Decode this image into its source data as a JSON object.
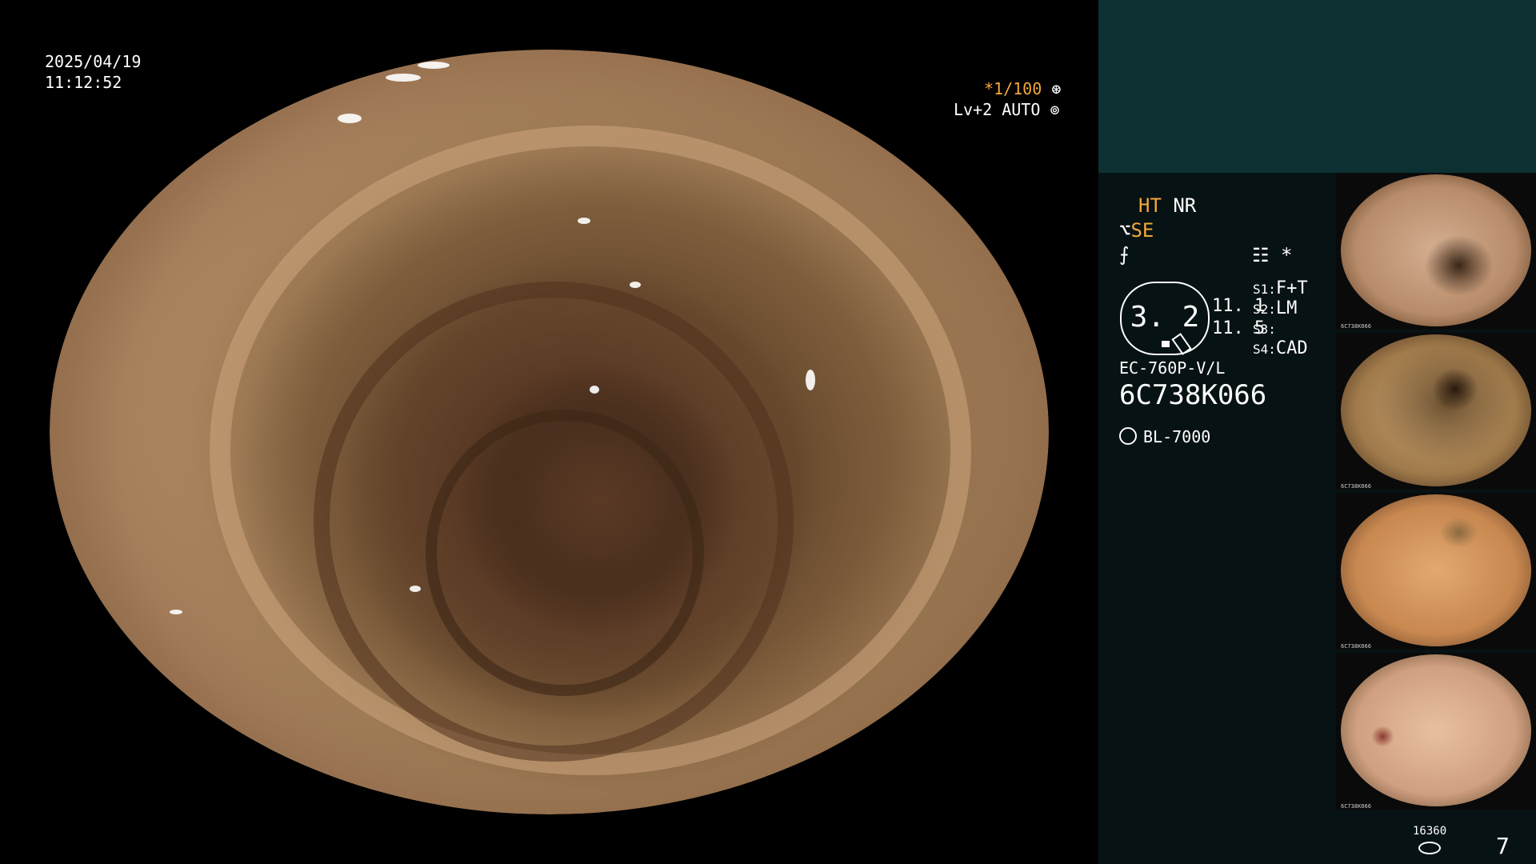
{
  "main": {
    "date": "2025/04/19",
    "time": "11:12:52",
    "shutter_prefix": "*",
    "shutter": "1/100",
    "shutter_icon": "aperture-icon",
    "level": "Lv+2",
    "auto": "AUTO",
    "auto_icon": "iris-icon"
  },
  "panel": {
    "ht": "HT",
    "nr": "NR",
    "se": "SE",
    "se_icon": "structure-enhance-icon",
    "f_icon": "color-mode-icon",
    "mode_icon": "settings-icon",
    "star": "*",
    "level_value": "3. 2",
    "num_a": "11. 1",
    "num_b": "11. 5",
    "s1_label": "S1",
    "s1_value": "F+T",
    "s2_label": "S2",
    "s2_value": "LM",
    "s3_label": "S3",
    "s3_value": "",
    "s4_label": "S4",
    "s4_value": "CAD",
    "scope_model": "EC-760P-V/L",
    "scope_serial": "6C738K066",
    "light_source": "BL-7000",
    "light_icon": "light-source-icon",
    "counter_small": "16360",
    "counter_main": "7"
  },
  "thumbnails": [
    {
      "label": "6C738K066"
    },
    {
      "label": "6C738K066"
    },
    {
      "label": "6C738K066"
    },
    {
      "label": "6C738K066"
    }
  ],
  "colors": {
    "accent": "#f3a73a",
    "panel_bg": "#071214",
    "panel_top": "#0d3132"
  }
}
